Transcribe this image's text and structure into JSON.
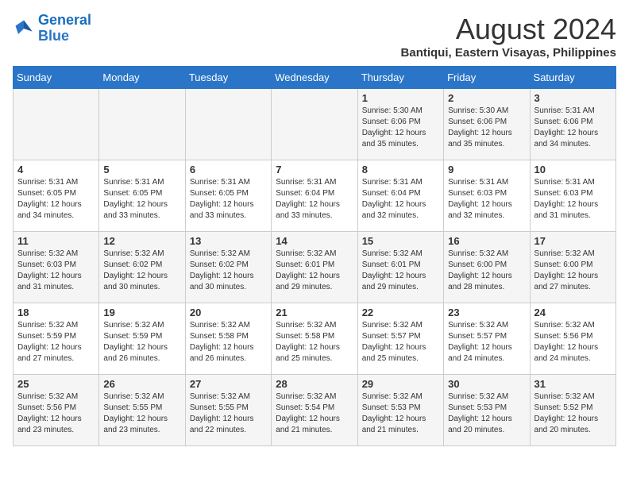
{
  "logo": {
    "line1": "General",
    "line2": "Blue"
  },
  "title": "August 2024",
  "subtitle": "Bantiqui, Eastern Visayas, Philippines",
  "days_of_week": [
    "Sunday",
    "Monday",
    "Tuesday",
    "Wednesday",
    "Thursday",
    "Friday",
    "Saturday"
  ],
  "weeks": [
    [
      {
        "day": "",
        "info": ""
      },
      {
        "day": "",
        "info": ""
      },
      {
        "day": "",
        "info": ""
      },
      {
        "day": "",
        "info": ""
      },
      {
        "day": "1",
        "info": "Sunrise: 5:30 AM\nSunset: 6:06 PM\nDaylight: 12 hours\nand 35 minutes."
      },
      {
        "day": "2",
        "info": "Sunrise: 5:30 AM\nSunset: 6:06 PM\nDaylight: 12 hours\nand 35 minutes."
      },
      {
        "day": "3",
        "info": "Sunrise: 5:31 AM\nSunset: 6:06 PM\nDaylight: 12 hours\nand 34 minutes."
      }
    ],
    [
      {
        "day": "4",
        "info": "Sunrise: 5:31 AM\nSunset: 6:05 PM\nDaylight: 12 hours\nand 34 minutes."
      },
      {
        "day": "5",
        "info": "Sunrise: 5:31 AM\nSunset: 6:05 PM\nDaylight: 12 hours\nand 33 minutes."
      },
      {
        "day": "6",
        "info": "Sunrise: 5:31 AM\nSunset: 6:05 PM\nDaylight: 12 hours\nand 33 minutes."
      },
      {
        "day": "7",
        "info": "Sunrise: 5:31 AM\nSunset: 6:04 PM\nDaylight: 12 hours\nand 33 minutes."
      },
      {
        "day": "8",
        "info": "Sunrise: 5:31 AM\nSunset: 6:04 PM\nDaylight: 12 hours\nand 32 minutes."
      },
      {
        "day": "9",
        "info": "Sunrise: 5:31 AM\nSunset: 6:03 PM\nDaylight: 12 hours\nand 32 minutes."
      },
      {
        "day": "10",
        "info": "Sunrise: 5:31 AM\nSunset: 6:03 PM\nDaylight: 12 hours\nand 31 minutes."
      }
    ],
    [
      {
        "day": "11",
        "info": "Sunrise: 5:32 AM\nSunset: 6:03 PM\nDaylight: 12 hours\nand 31 minutes."
      },
      {
        "day": "12",
        "info": "Sunrise: 5:32 AM\nSunset: 6:02 PM\nDaylight: 12 hours\nand 30 minutes."
      },
      {
        "day": "13",
        "info": "Sunrise: 5:32 AM\nSunset: 6:02 PM\nDaylight: 12 hours\nand 30 minutes."
      },
      {
        "day": "14",
        "info": "Sunrise: 5:32 AM\nSunset: 6:01 PM\nDaylight: 12 hours\nand 29 minutes."
      },
      {
        "day": "15",
        "info": "Sunrise: 5:32 AM\nSunset: 6:01 PM\nDaylight: 12 hours\nand 29 minutes."
      },
      {
        "day": "16",
        "info": "Sunrise: 5:32 AM\nSunset: 6:00 PM\nDaylight: 12 hours\nand 28 minutes."
      },
      {
        "day": "17",
        "info": "Sunrise: 5:32 AM\nSunset: 6:00 PM\nDaylight: 12 hours\nand 27 minutes."
      }
    ],
    [
      {
        "day": "18",
        "info": "Sunrise: 5:32 AM\nSunset: 5:59 PM\nDaylight: 12 hours\nand 27 minutes."
      },
      {
        "day": "19",
        "info": "Sunrise: 5:32 AM\nSunset: 5:59 PM\nDaylight: 12 hours\nand 26 minutes."
      },
      {
        "day": "20",
        "info": "Sunrise: 5:32 AM\nSunset: 5:58 PM\nDaylight: 12 hours\nand 26 minutes."
      },
      {
        "day": "21",
        "info": "Sunrise: 5:32 AM\nSunset: 5:58 PM\nDaylight: 12 hours\nand 25 minutes."
      },
      {
        "day": "22",
        "info": "Sunrise: 5:32 AM\nSunset: 5:57 PM\nDaylight: 12 hours\nand 25 minutes."
      },
      {
        "day": "23",
        "info": "Sunrise: 5:32 AM\nSunset: 5:57 PM\nDaylight: 12 hours\nand 24 minutes."
      },
      {
        "day": "24",
        "info": "Sunrise: 5:32 AM\nSunset: 5:56 PM\nDaylight: 12 hours\nand 24 minutes."
      }
    ],
    [
      {
        "day": "25",
        "info": "Sunrise: 5:32 AM\nSunset: 5:56 PM\nDaylight: 12 hours\nand 23 minutes."
      },
      {
        "day": "26",
        "info": "Sunrise: 5:32 AM\nSunset: 5:55 PM\nDaylight: 12 hours\nand 23 minutes."
      },
      {
        "day": "27",
        "info": "Sunrise: 5:32 AM\nSunset: 5:55 PM\nDaylight: 12 hours\nand 22 minutes."
      },
      {
        "day": "28",
        "info": "Sunrise: 5:32 AM\nSunset: 5:54 PM\nDaylight: 12 hours\nand 21 minutes."
      },
      {
        "day": "29",
        "info": "Sunrise: 5:32 AM\nSunset: 5:53 PM\nDaylight: 12 hours\nand 21 minutes."
      },
      {
        "day": "30",
        "info": "Sunrise: 5:32 AM\nSunset: 5:53 PM\nDaylight: 12 hours\nand 20 minutes."
      },
      {
        "day": "31",
        "info": "Sunrise: 5:32 AM\nSunset: 5:52 PM\nDaylight: 12 hours\nand 20 minutes."
      }
    ]
  ]
}
